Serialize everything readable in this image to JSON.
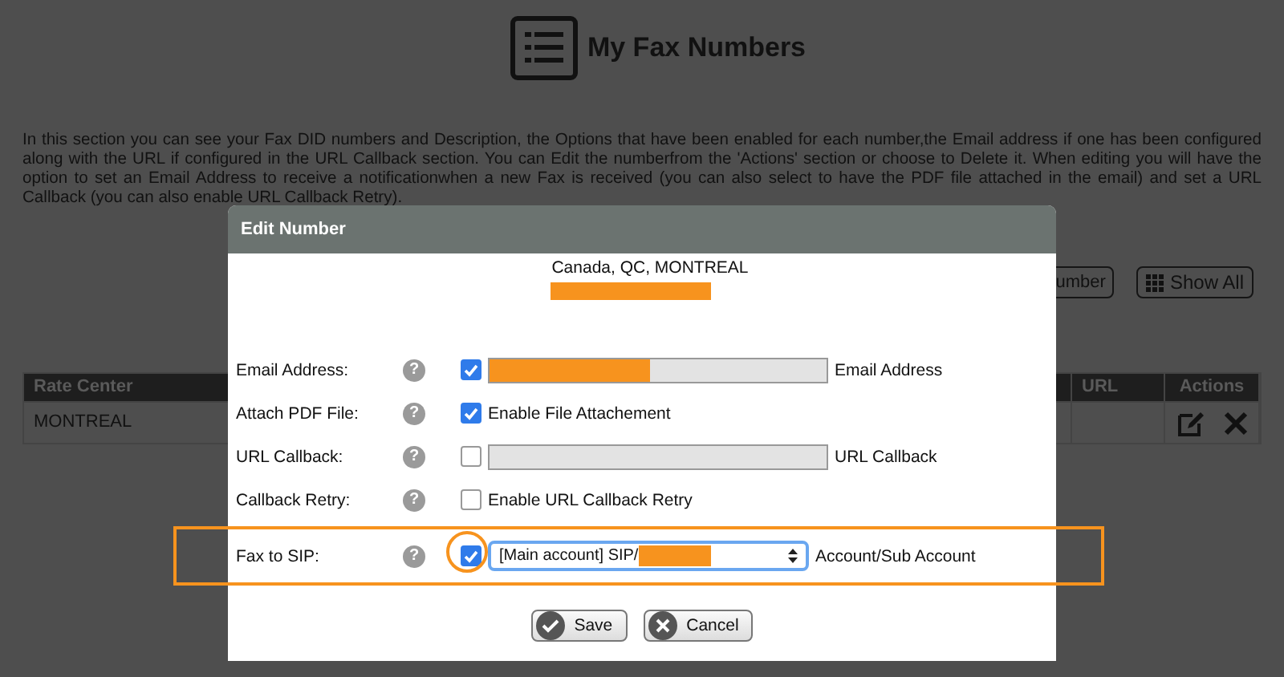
{
  "page": {
    "title": "My Fax Numbers",
    "description": "In this section you can see your Fax DID numbers and Description, the Options that have been enabled for each number,the Email address if one has been configured along with the URL if configured in the URL Callback section. You can Edit the numberfrom the 'Actions' section or choose to Delete it. When editing you will have the option to set an Email Address to receive a notificationwhen a new Fax is received (you can also select to have the PDF file attached in the email) and set a URL Callback (you can also enable URL Callback Retry).",
    "toolbar_buttons": [
      {
        "kind": "plain",
        "label": "umber"
      },
      {
        "kind": "grid",
        "label": "Show All"
      }
    ],
    "table": {
      "columns": [
        "Rate Center",
        "URL",
        "Actions"
      ],
      "rows": [
        {
          "rate_center": "MONTREAL"
        }
      ]
    }
  },
  "dialog": {
    "title": "Edit Number",
    "location": "Canada, QC, MONTREAL",
    "location_redacted": true,
    "fields": [
      {
        "kind": "text",
        "label": "Email Address:",
        "help": "?",
        "checked": true,
        "redacted": true,
        "suffix": "Email Address",
        "highlighted": false
      },
      {
        "kind": "check",
        "label": "Attach PDF File:",
        "help": "?",
        "checked": true,
        "suffix": "Enable File Attachement",
        "highlighted": false
      },
      {
        "kind": "text",
        "label": "URL Callback:",
        "help": "?",
        "checked": false,
        "redacted": false,
        "suffix": "URL Callback",
        "highlighted": false
      },
      {
        "kind": "check",
        "label": "Callback Retry:",
        "help": "?",
        "checked": false,
        "suffix": "Enable URL Callback Retry",
        "highlighted": false
      },
      {
        "kind": "select",
        "label": "Fax to SIP:",
        "help": "?",
        "checked": true,
        "value": "[Main account] SIP/",
        "redacted": true,
        "suffix": "Account/Sub Account",
        "highlighted": true
      }
    ],
    "buttons": [
      {
        "kind": "save",
        "label": "Save"
      },
      {
        "kind": "cancel",
        "label": "Cancel"
      }
    ]
  }
}
